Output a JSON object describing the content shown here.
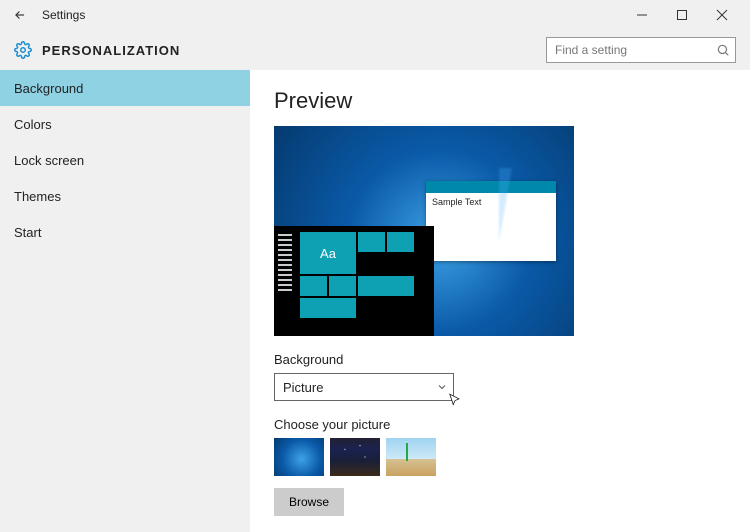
{
  "titlebar": {
    "title": "Settings"
  },
  "header": {
    "section": "PERSONALIZATION",
    "search_placeholder": "Find a setting"
  },
  "sidebar": {
    "items": [
      {
        "label": "Background",
        "active": true
      },
      {
        "label": "Colors",
        "active": false
      },
      {
        "label": "Lock screen",
        "active": false
      },
      {
        "label": "Themes",
        "active": false
      },
      {
        "label": "Start",
        "active": false
      }
    ]
  },
  "main": {
    "heading": "Preview",
    "sample_text": "Sample Text",
    "tile_text": "Aa",
    "bg_label": "Background",
    "bg_select_value": "Picture",
    "choose_label": "Choose your picture",
    "browse_label": "Browse"
  }
}
